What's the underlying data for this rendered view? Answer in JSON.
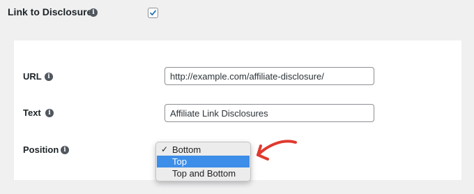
{
  "link_to_disclosures": {
    "label": "Link to Disclosures",
    "checked": true
  },
  "fields": {
    "url": {
      "label": "URL",
      "value": "http://example.com/affiliate-disclosure/"
    },
    "text": {
      "label": "Text",
      "value": "Affiliate Link Disclosures"
    },
    "position": {
      "label": "Position",
      "selected": "Bottom",
      "options": [
        "Bottom",
        "Top",
        "Top and Bottom"
      ],
      "highlighted": "Top"
    }
  },
  "info_icon_glyph": "i",
  "check_glyph": "✓",
  "colors": {
    "checkbox_tick": "#2271b1",
    "highlight": "#3d8ee8",
    "annotation_arrow": "#e03a2f"
  }
}
